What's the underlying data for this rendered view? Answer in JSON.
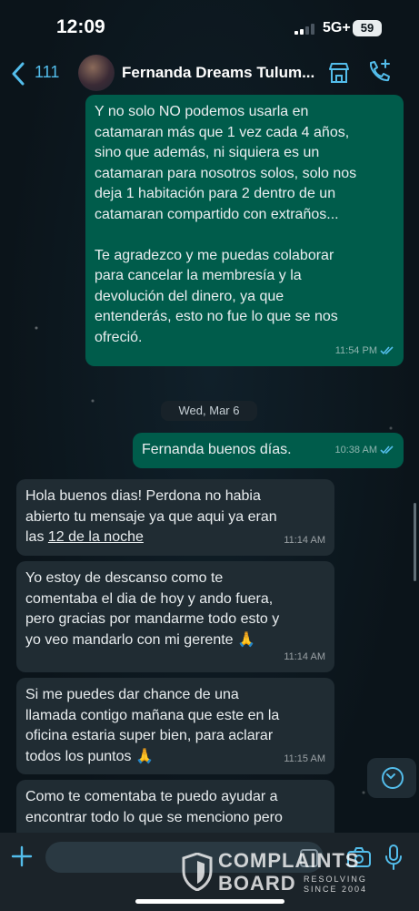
{
  "status_bar": {
    "time": "12:09",
    "network": "5G+",
    "battery": "59"
  },
  "header": {
    "back_count": "111",
    "contact_name": "Fernanda Dreams Tulum..."
  },
  "messages": [
    {
      "text": "Y no solo NO podemos usarla en\ncatamaran más que 1 vez cada 4 años,\nsino que además, ni siquiera es un\ncatamaran para nosotros solos, solo nos\ndeja 1 habitación para 2 dentro de un\ncatamaran compartido con extraños...\n\nTe agradezco y me puedas colaborar\npara cancelar la membresía y la\ndevolución del dinero, ya que\nentenderás, esto no fue lo que se nos\nofreció.",
      "time": "11:54 PM"
    },
    {
      "text": "Fernanda buenos días.",
      "time": "10:38 AM"
    },
    {
      "text_before": "Hola buenos dias! Perdona no habia\nabierto tu mensaje ya que aqui ya eran\nlas ",
      "link": "12 de la noche",
      "time": "11:14 AM"
    },
    {
      "text": "Yo estoy de descanso como te\ncomentaba el dia de hoy y ando fuera,\npero gracias por mandarme todo esto y\nyo veo mandarlo con mi gerente 🙏",
      "time": "11:14 AM"
    },
    {
      "text": "Si me puedes dar chance de una\nllamada contigo mañana que este en la\noficina estaria super bien, para aclarar\ntodos los puntos 🙏",
      "time": "11:15 AM"
    },
    {
      "text": "Como te comentaba te puedo ayudar a\nencontrar todo lo que se menciono pero",
      "time": ""
    }
  ],
  "date_separator": "Wed, Mar 6",
  "input": {
    "placeholder": ""
  },
  "watermark": {
    "line1": "COMPLAINTS",
    "line2": "BOARD",
    "tag1": "RESOLVING",
    "tag2": "SINCE 2004"
  },
  "colors": {
    "outgoing": "#005c4b",
    "incoming": "#202c33",
    "accent": "#53bdeb",
    "background": "#0b141a"
  },
  "icons": [
    "back-chevron-icon",
    "store-icon",
    "add-call-icon",
    "double-check-icon",
    "scroll-down-icon",
    "plus-icon",
    "sticker-icon",
    "camera-icon",
    "mic-icon"
  ]
}
